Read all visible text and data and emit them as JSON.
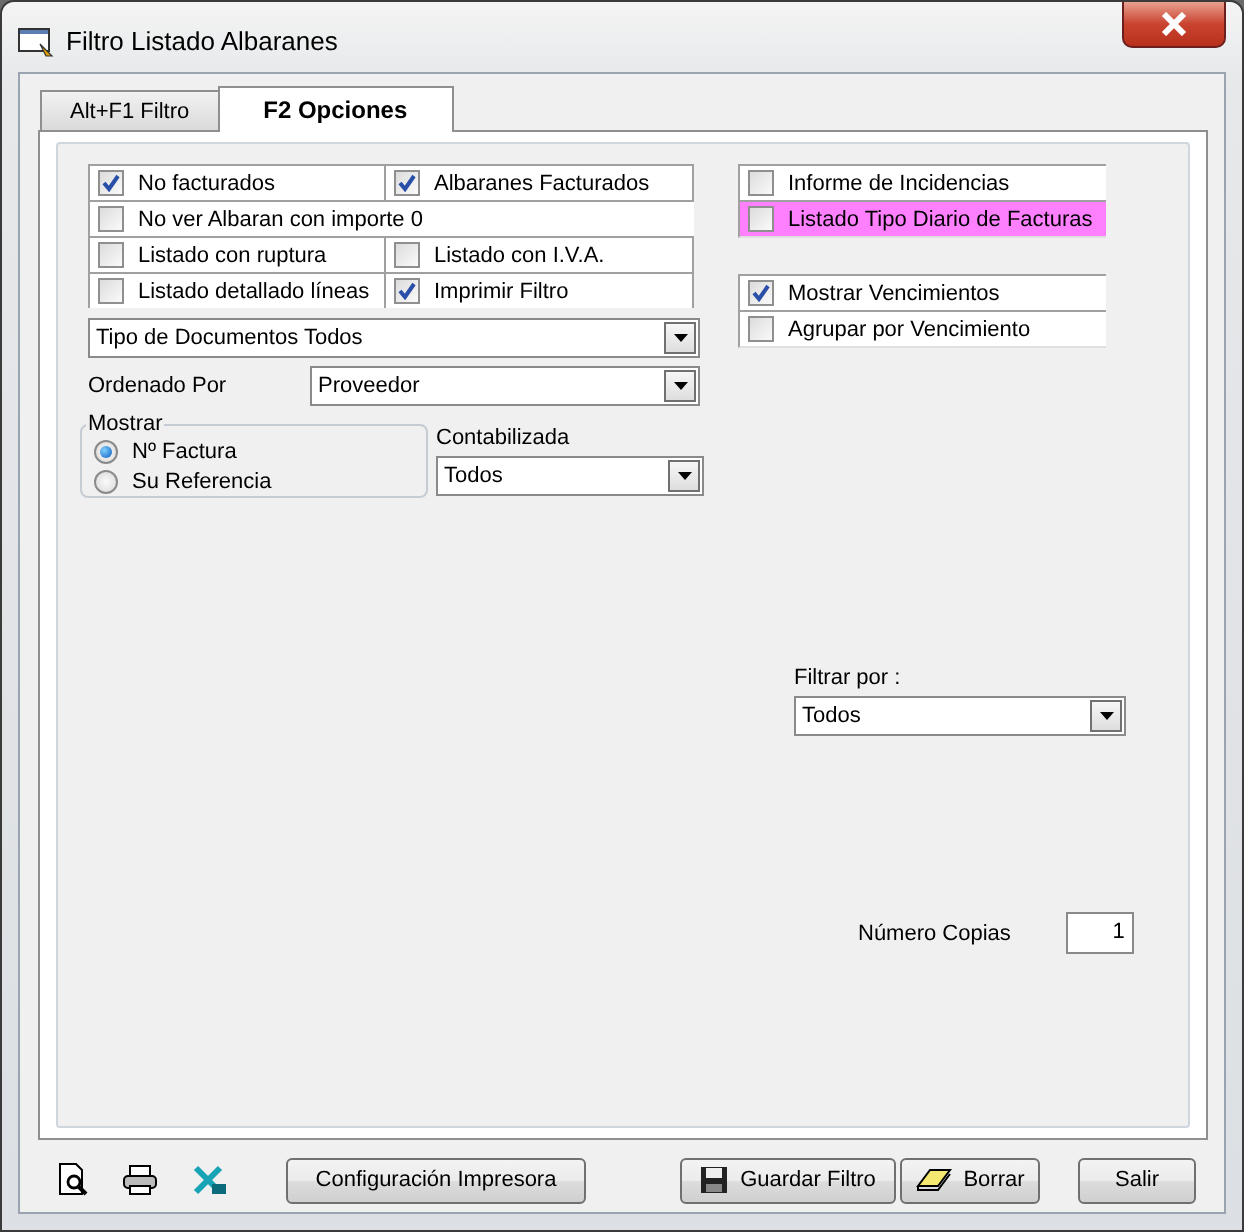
{
  "window": {
    "title": "Filtro Listado Albaranes"
  },
  "tabs": [
    {
      "label": "Alt+F1 Filtro",
      "selected": false
    },
    {
      "label": "F2 Opciones",
      "selected": true
    }
  ],
  "options_left": [
    {
      "cells": [
        {
          "label": "No facturados",
          "checked": true
        },
        {
          "label": "Albaranes Facturados",
          "checked": true
        }
      ]
    },
    {
      "cells": [
        {
          "label": "No ver Albaran con importe 0",
          "checked": false
        }
      ]
    },
    {
      "cells": [
        {
          "label": "Listado con ruptura",
          "checked": false
        },
        {
          "label": "Listado con I.V.A.",
          "checked": false
        }
      ]
    },
    {
      "cells": [
        {
          "label": "Listado detallado líneas",
          "checked": false
        },
        {
          "label": "Imprimir Filtro",
          "checked": true
        }
      ]
    }
  ],
  "options_right": [
    [
      {
        "label": "Informe de Incidencias",
        "checked": false,
        "highlighted": false
      },
      {
        "label": "Listado Tipo Diario de Facturas",
        "checked": false,
        "highlighted": true
      }
    ],
    [
      {
        "label": "Mostrar Vencimientos",
        "checked": true,
        "highlighted": false
      },
      {
        "label": "Agrupar por Vencimiento",
        "checked": false,
        "highlighted": false
      }
    ]
  ],
  "document_type": {
    "value": "Tipo de Documentos Todos"
  },
  "sort": {
    "label": "Ordenado Por",
    "value": "Proveedor"
  },
  "show": {
    "label": "Mostrar",
    "options": [
      {
        "label": "Nº Factura",
        "selected": true
      },
      {
        "label": "Su Referencia",
        "selected": false
      }
    ]
  },
  "accounted": {
    "label": "Contabilizada",
    "value": "Todos"
  },
  "filter_by": {
    "label": "Filtrar por :",
    "value": "Todos"
  },
  "copies": {
    "label": "Número Copias",
    "value": "1"
  },
  "buttons": [
    {
      "label": "Configuración Impresora",
      "kind": "plain"
    },
    {
      "label": "Guardar Filtro",
      "kind": "save"
    },
    {
      "label": "Borrar",
      "kind": "erase"
    },
    {
      "label": "Salir",
      "kind": "plain"
    }
  ]
}
